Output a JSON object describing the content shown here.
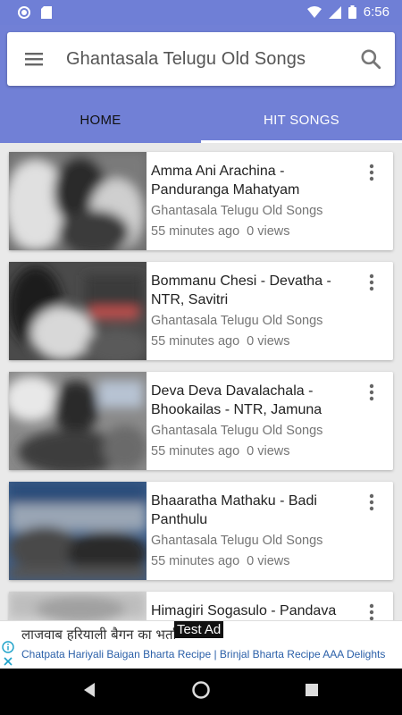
{
  "status_bar": {
    "time": "6:56"
  },
  "app_bar": {
    "title": "Ghantasala Telugu Old Songs"
  },
  "tabs": [
    {
      "label": "HOME",
      "active": true
    },
    {
      "label": "HIT SONGS",
      "active": false
    }
  ],
  "videos": [
    {
      "title": "Amma Ani Arachina - Panduranga Mahatyam",
      "channel": "Ghantasala Telugu Old Songs",
      "time_ago": "55 minutes ago",
      "views": "0 views"
    },
    {
      "title": "Bommanu Chesi - Devatha - NTR, Savitri",
      "channel": "Ghantasala Telugu Old Songs",
      "time_ago": "55 minutes ago",
      "views": "0 views"
    },
    {
      "title": "Deva Deva Davalachala - Bhookailas - NTR, Jamuna",
      "channel": "Ghantasala Telugu Old Songs",
      "time_ago": "55 minutes ago",
      "views": "0 views"
    },
    {
      "title": "Bhaaratha Mathaku - Badi Panthulu",
      "channel": "Ghantasala Telugu Old Songs",
      "time_ago": "55 minutes ago",
      "views": "0 views"
    },
    {
      "title": "Himagiri Sogasulo - Pandava",
      "channel": "",
      "time_ago": "",
      "views": ""
    }
  ],
  "ad": {
    "headline": "लाजवाब हरियाली बैगन का भर्ता",
    "subtext": "Chatpata Hariyali Baigan Bharta Recipe | Brinjal Bharta Recipe AAA Delights",
    "label": "Test Ad"
  },
  "colors": {
    "primary": "#7180d6",
    "status_bar": "#6f7fd6",
    "nav_bar": "#000000"
  }
}
